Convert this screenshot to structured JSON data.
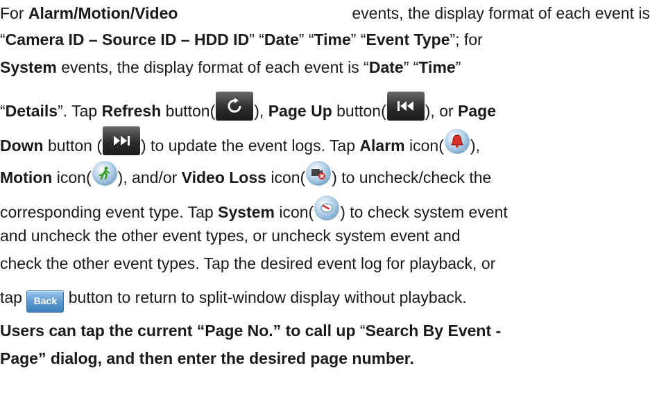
{
  "paragraph": {
    "l1": {
      "a": "For ",
      "b": "Alarm/Motion/Video",
      "c": " events, the display format of each event is"
    },
    "l2": {
      "a": "“",
      "b": "Camera ID – Source ID – HDD ID",
      "c": "” “",
      "d": "Date",
      "e": "” “",
      "f": "Time",
      "g": "” “",
      "h": "Event Type",
      "i": "”; for"
    },
    "l3": {
      "a": "System",
      "b": " events, the display format of each event is “",
      "c": "Date",
      "d": "” “",
      "e": "Time",
      "f": "”"
    },
    "l4": {
      "a": "“",
      "b": "Details",
      "c": "”. Tap ",
      "d": "Refresh",
      "e": " button(",
      "f": "), ",
      "g": "Page Up",
      "h": " button(",
      "i": "), or ",
      "j": "Page"
    },
    "l5": {
      "a": "Down",
      "b": " button (",
      "c": ") to update the event logs. Tap ",
      "d": "Alarm",
      "e": " icon(",
      "f": "),"
    },
    "l6": {
      "a": "Motion",
      "b": " icon(",
      "c": "), and/or ",
      "d": "Video Loss",
      "e": " icon(",
      "f": ") to uncheck/check the"
    },
    "l7": {
      "a": "corresponding event type. Tap ",
      "b": "System",
      "c": " icon(",
      "d": ") to check system event"
    },
    "l8": {
      "a": "and uncheck the other event types, or uncheck system event and"
    },
    "l9": {
      "a": "check the other event types. Tap the desired event log for playback, or"
    },
    "l10": {
      "a": "tap ",
      "b": " button to return to split-window display without playback."
    },
    "l11": {
      "a": "Users can tap the current “Page No.” to call up ",
      "b": "“",
      "c": "Search By Event -"
    },
    "l12": {
      "a": "Page",
      "b": "” dialog, and then enter the desired page number."
    }
  },
  "icons": {
    "refresh": "refresh-icon",
    "page_up": "skip-back-icon",
    "page_down": "skip-forward-icon",
    "alarm": "alarm-bell-icon",
    "motion": "motion-runner-icon",
    "video_loss": "video-loss-icon",
    "system": "system-icon"
  },
  "back_button": {
    "label": "Back"
  },
  "colors": {
    "text": "#1a1a1a",
    "button_dark": "#2c2c2c",
    "back_blue": "#5e9bd3",
    "alarm_red": "#d9302c",
    "motion_green": "#3a9a2a"
  }
}
